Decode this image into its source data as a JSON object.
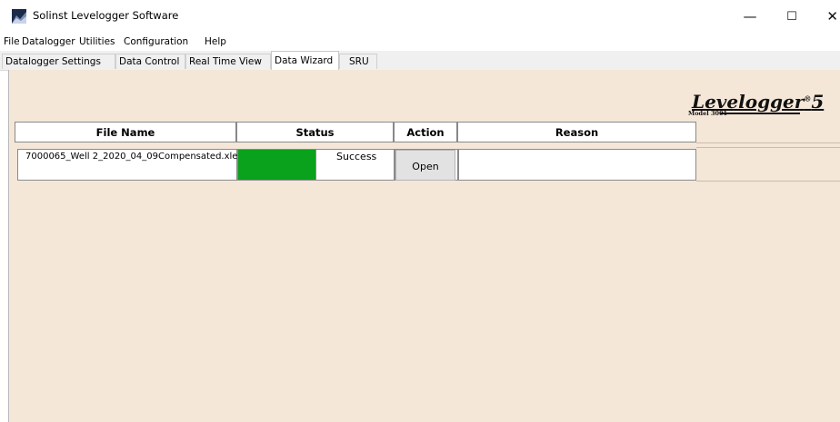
{
  "window": {
    "title": "Solinst Levelogger Software",
    "controls": {
      "minimize": "—",
      "maximize": "☐",
      "close": "✕"
    }
  },
  "menu": [
    "File",
    "Datalogger",
    "Utilities",
    "Configuration",
    "Help"
  ],
  "tabs": [
    {
      "label": "Datalogger Settings",
      "active": false
    },
    {
      "label": "Data Control",
      "active": false
    },
    {
      "label": "Real Time View",
      "active": false
    },
    {
      "label": "Data Wizard",
      "active": true
    },
    {
      "label": "SRU",
      "active": false
    }
  ],
  "logo": {
    "brand": "Levelogger",
    "version": "5",
    "model": "Model 3001"
  },
  "table": {
    "headers": {
      "file_name": "File Name",
      "status": "Status",
      "action": "Action",
      "reason": "Reason"
    },
    "rows": [
      {
        "file_name": "7000065_Well 2_2020_04_09Compensated.xle",
        "status": "Success",
        "status_color": "#0aa11c",
        "action": "Open",
        "reason": ""
      }
    ]
  },
  "colors": {
    "content_background": "#f4e7d8",
    "success": "#0aa11c"
  }
}
